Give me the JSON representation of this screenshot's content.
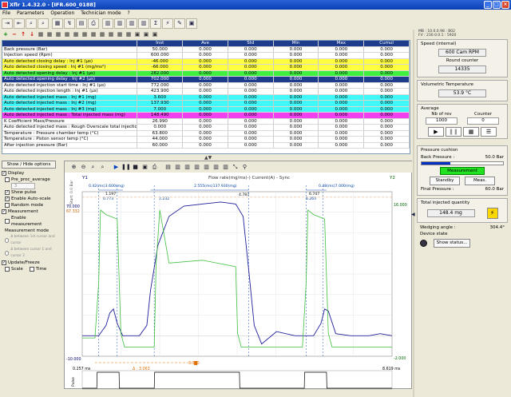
{
  "window": {
    "title": "Xflr 1.4.32.0 - [IFR.600_0188]",
    "min": "_",
    "max": "□",
    "close": "×"
  },
  "menu": [
    "File",
    "Parameters",
    "Operation",
    "Technician mode",
    "?"
  ],
  "toolbar": {
    "icons": [
      "arrows-in-icon",
      "arrows-out-icon",
      "zoom-icon",
      "zoom-out-icon",
      "calendar-icon",
      "graph-icon",
      "open-icon",
      "print-icon",
      "table-icon",
      "table2-icon",
      "table3-icon",
      "table4-icon",
      "stats-icon",
      "bolt-icon",
      "notes-icon",
      "save-icon"
    ]
  },
  "toolbar2": {
    "add": "+",
    "remove": "−",
    "up": "↑",
    "down": "↓"
  },
  "grid": {
    "columns": [
      "",
      "Inst",
      "Ave",
      "Std",
      "Min",
      "Max",
      "Cumul"
    ],
    "rows": [
      {
        "name": "Back pressure (Bar)",
        "cells": [
          "50.000",
          "0.000",
          "0.000",
          "0.000",
          "0.000",
          "0.000"
        ],
        "color": "white"
      },
      {
        "name": "Injection speed (Rpm)",
        "cells": [
          "600.000",
          "0.000",
          "0.000",
          "0.000",
          "0.000",
          "0.000"
        ],
        "color": "white"
      },
      {
        "name": "Auto detected closing delay : Inj #1 (µs)",
        "cells": [
          "-46.000",
          "0.000",
          "0.000",
          "0.000",
          "0.000",
          "0.000"
        ],
        "color": "yellow"
      },
      {
        "name": "Auto detected closing speed : Inj #1 (mg/ms²)",
        "cells": [
          "-66.000",
          "0.000",
          "0.000",
          "0.000",
          "0.000",
          "0.000"
        ],
        "color": "yellow"
      },
      {
        "name": "Auto detected opening delay : Inj #1 (µs)",
        "cells": [
          "282.000",
          "0.000",
          "0.000",
          "0.000",
          "0.000",
          "0.000"
        ],
        "color": "green"
      },
      {
        "name": "Auto detected opening delay : Inj #2 (µs)",
        "cells": [
          "702.000",
          "0.000",
          "0.000",
          "0.000",
          "0.000",
          "0.000"
        ],
        "color": "selected"
      },
      {
        "name": "Auto detected injection start time : Inj #1 (µs)",
        "cells": [
          "772.000",
          "0.000",
          "0.000",
          "0.000",
          "0.000",
          "0.000"
        ],
        "color": "white"
      },
      {
        "name": "Auto detected injection length : Inj #1 (µs)",
        "cells": [
          "423.900",
          "0.000",
          "0.000",
          "0.000",
          "0.000",
          "0.000"
        ],
        "color": "white"
      },
      {
        "name": "Auto detected injected mass : Inj #1 (mg)",
        "cells": [
          "3.600",
          "0.000",
          "0.000",
          "0.000",
          "0.000",
          "0.000"
        ],
        "color": "cyan"
      },
      {
        "name": "Auto detected injected mass : Inj #2 (mg)",
        "cells": [
          "137.930",
          "0.000",
          "0.000",
          "0.000",
          "0.000",
          "0.000"
        ],
        "color": "cyan"
      },
      {
        "name": "Auto detected injected mass : Inj #3 (mg)",
        "cells": [
          "7.000",
          "0.000",
          "0.000",
          "0.000",
          "0.000",
          "0.000"
        ],
        "color": "cyan"
      },
      {
        "name": "Auto detected injected mass : Total injected mass (mg)",
        "cells": [
          "148.490",
          "0.000",
          "0.000",
          "0.000",
          "0.000",
          "0.000"
        ],
        "color": "magenta"
      },
      {
        "name": "K Coefficient Mass/Pressure",
        "cells": [
          "26.990",
          "0.000",
          "0.000",
          "0.000",
          "0.000",
          "0.000"
        ],
        "color": "white"
      },
      {
        "name": "Auto detected injected mass : Rough Overscale total injection (mg)",
        "cells": [
          "0.000",
          "0.000",
          "0.000",
          "0.000",
          "0.000",
          "0.000"
        ],
        "color": "white"
      },
      {
        "name": "Temperature : Pressure chamber temp (°C)",
        "cells": [
          "63.800",
          "0.000",
          "0.000",
          "0.000",
          "0.000",
          "0.000"
        ],
        "color": "white"
      },
      {
        "name": "Temperature : Piston sensor temp (°C)",
        "cells": [
          "44.000",
          "0.000",
          "0.000",
          "0.000",
          "0.000",
          "0.000"
        ],
        "color": "white"
      },
      {
        "name": "After injection pressure (Bar)",
        "cells": [
          "60.000",
          "0.000",
          "0.000",
          "0.000",
          "0.000",
          "0.000"
        ],
        "color": "white"
      }
    ]
  },
  "left": {
    "show_hide": "Show / Hide options",
    "display": "Display",
    "pre_proc": "Pre_proc_average",
    "pre_proc_value": "3",
    "show_pulse": "Show pulse",
    "enable_autoscale": "Enable Auto-scale",
    "random_mode": "Random mode",
    "measurement": "Measurement",
    "enable_measurement": "Enable measurement",
    "measurement_mode": "Measurement mode",
    "mode1": "Δ between 1st cursor and cursor",
    "mode2": "Δ between cursor 1 and cursor 2",
    "update_freeze": "Update/Freeze",
    "scale": "Scale",
    "time": "Time"
  },
  "plot": {
    "toolbar_icons": [
      "zoom-in-icon",
      "zoom-out-icon",
      "zoom-area-icon",
      "zoom-reset-icon",
      "play-icon",
      "pause-icon",
      "stop-icon",
      "save-icon",
      "print-icon",
      "chart1-icon",
      "chart2-icon",
      "chart3-icon",
      "chart4-icon",
      "chart5-icon",
      "chart6-icon",
      "chart7-icon",
      "chart8-icon",
      "chart9-icon"
    ],
    "title": "Flow rate(mg/ms)-) Current(A) - Sync",
    "y1_label": "Y1",
    "y2_label": "Y2",
    "y_left_axis": "Start: 0.0 Bar",
    "y1_top": "70.000",
    "y1_second": "67.332",
    "y1_bottom": "-10.000",
    "y2_top": "16.000",
    "y2_bottom": "-2.000",
    "segment1_label": "0.42(ms)3.600(mg)",
    "segment2_label": "2.555(ms)137.930(mg)",
    "segment3_label": "0.48(ms)7.000(mg)",
    "cursor1_top": "1.197",
    "cursor1_bot": "0.773",
    "cursor2": "2.232",
    "cursor3": "4.787",
    "cursor4_top": "6.747",
    "cursor4_bot": "6.260",
    "x_start": "0.257 ms",
    "x_end": "8.619 ms",
    "delta": "Δ : 3.063",
    "marker": "3.320",
    "pulse_label": "Pulse"
  },
  "chart_data": {
    "type": "line",
    "title": "Flow rate(mg/ms)-) Current(A) - Sync",
    "xlabel": "",
    "ylabel": "",
    "xlim": [
      0.257,
      8.619
    ],
    "ylim": [
      -10,
      70
    ],
    "y2lim": [
      -2,
      16
    ],
    "grid": true,
    "series": [
      {
        "name": "Flow rate(mg/ms)",
        "color": "#20209a",
        "x": [
          0.257,
          0.7,
          0.9,
          1.0,
          1.1,
          1.2,
          1.35,
          1.6,
          1.8,
          2.0,
          2.1,
          2.3,
          2.6,
          3.0,
          3.5,
          4.0,
          4.4,
          4.6,
          4.75,
          4.9,
          5.1,
          5.5,
          6.0,
          6.5,
          6.7,
          6.8,
          6.9,
          7.1,
          7.5,
          8.0,
          8.3,
          8.619
        ],
        "y": [
          0,
          0,
          5,
          11,
          13,
          6,
          0,
          0,
          0,
          5,
          22,
          44,
          58,
          63,
          64,
          65,
          64,
          58,
          32,
          5,
          -4,
          2,
          0,
          0,
          6,
          13,
          12,
          1,
          0,
          0,
          1,
          0
        ]
      },
      {
        "name": "Current(A)",
        "color": "#40c040",
        "x": [
          0.257,
          0.6,
          0.7,
          0.75,
          0.9,
          1.2,
          1.3,
          1.4,
          1.8,
          2.2,
          2.25,
          2.35,
          2.6,
          3.5,
          4.4,
          4.45,
          4.55,
          5.0,
          6.2,
          6.3,
          6.35,
          6.5,
          6.8,
          6.9,
          7.0,
          7.5,
          8.619
        ],
        "y": [
          0,
          0,
          6,
          14,
          13.5,
          13,
          0.5,
          -1,
          -1,
          -1,
          8,
          14,
          8.2,
          8.5,
          7.8,
          0.5,
          -1,
          -1,
          -1,
          6,
          14,
          13.5,
          13,
          0.5,
          -1,
          -1,
          -1
        ]
      }
    ],
    "pulse": {
      "x": [
        0.257,
        0.65,
        0.66,
        1.25,
        1.26,
        2.2,
        2.21,
        4.5,
        4.51,
        6.25,
        6.26,
        6.85,
        6.86,
        8.619
      ],
      "y": [
        0,
        0,
        1,
        1,
        0,
        0,
        1,
        1,
        0,
        0,
        1,
        1,
        0,
        0
      ]
    }
  },
  "right": {
    "hdr1": "MB : 10.0.0.98 : B02",
    "hdr2": "FV : 230.0.0.1 : 5920",
    "speed_title": "Speed (internal)",
    "speed_value": "600 Cam RPM",
    "round_counter_label": "Round counter",
    "round_counter_value": "14335",
    "vol_temp_label": "Volumetric Temperature",
    "vol_temp_value": "53.9 °C",
    "average_label": "Average",
    "nb_rev_label": "Nb of rev",
    "counter_label": "Counter",
    "nb_rev_value": "1000",
    "counter_value": "0",
    "pressure_cushion": "Pressure cushion",
    "back_pressure_label": "Back Pressure :",
    "back_pressure_value": "50.0 Bar",
    "pressure_progress": 0.35,
    "measurement_btn": "Measurement",
    "standby_btn": "Standby",
    "meas_btn": "Meas.",
    "final_pressure_label": "Final Pressure :",
    "final_pressure_value": "60.0 Bar",
    "total_mass_label": "Total injected quantity",
    "total_mass_value": "148.4 mg",
    "wedging_label": "Wedging angle :",
    "wedging_value": "304.4°",
    "device_state_label": "Device state",
    "show_status_btn": "Show status..."
  }
}
